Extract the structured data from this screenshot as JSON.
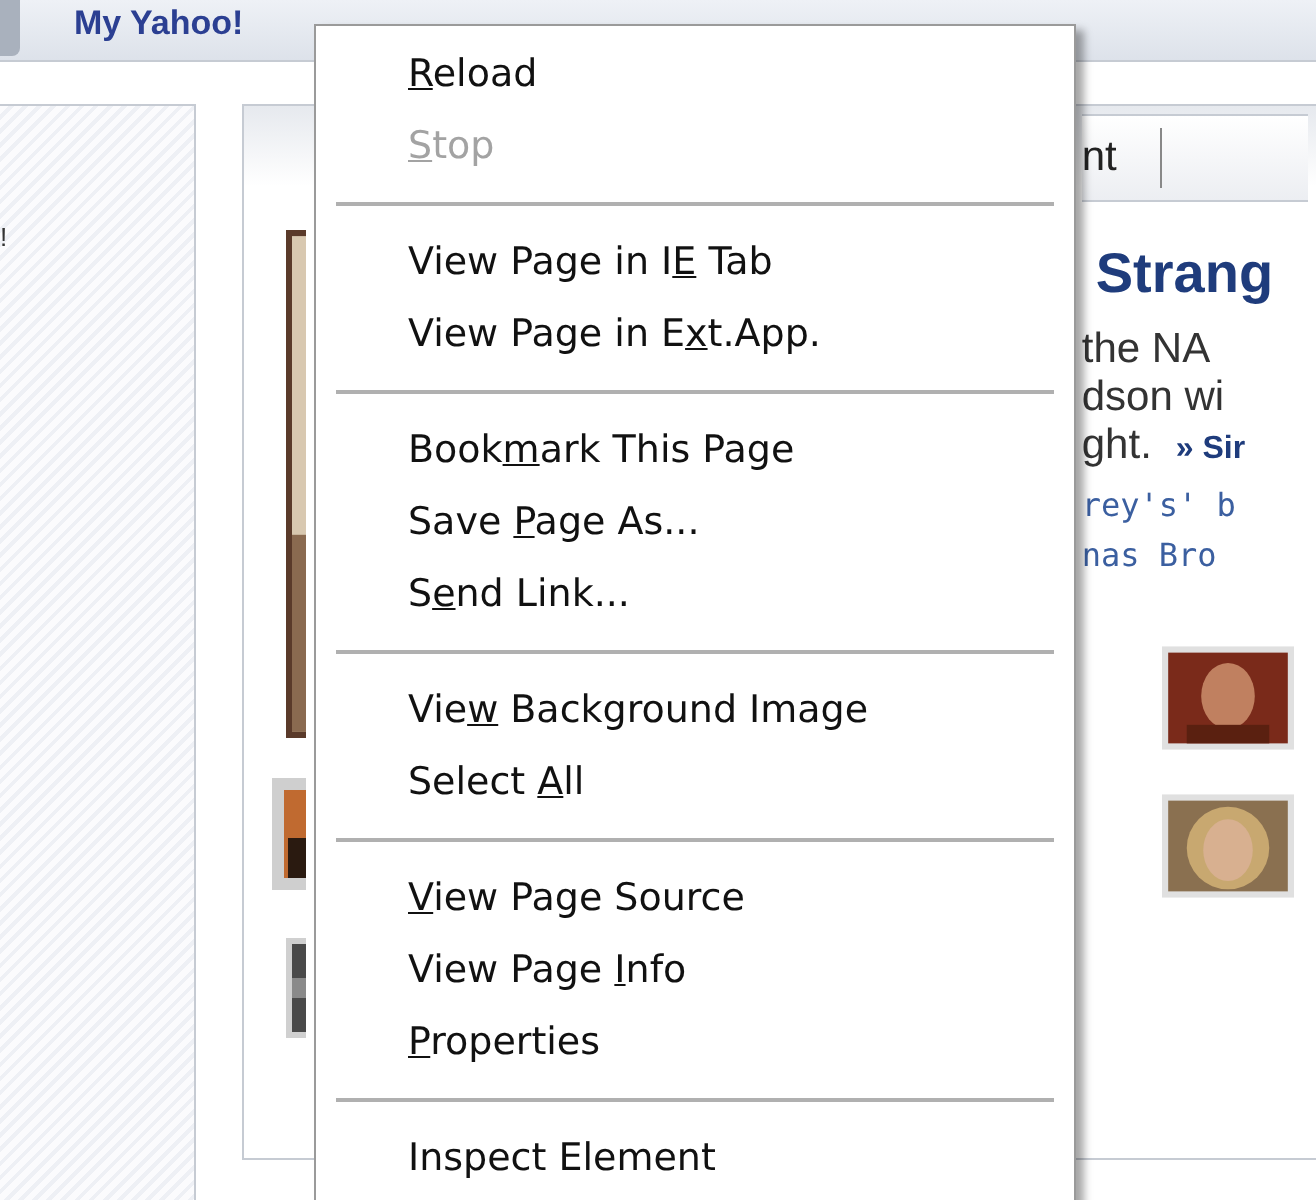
{
  "top_bar": {
    "link": "My Yahoo!"
  },
  "left_panel": {
    "texts": [
      "!"
    ]
  },
  "main_panel": {
    "tab": "nt",
    "headline": "Strang",
    "lines": [
      "the NA",
      "dson wi",
      "ght."
    ],
    "more_link": "» Sir",
    "links": [
      "rey's' b",
      "nas Bro"
    ]
  },
  "context_menu": {
    "groups": [
      [
        {
          "key": "R",
          "after": "eload",
          "disabled": false
        },
        {
          "key": "S",
          "after": "top",
          "disabled": true
        }
      ],
      [
        {
          "before": "View Page in I",
          "key": "E",
          "after": " Tab",
          "disabled": false
        },
        {
          "before": "View Page in E",
          "key": "x",
          "after": "t.App.",
          "disabled": false
        }
      ],
      [
        {
          "before": "Book",
          "key": "m",
          "after": "ark This Page",
          "disabled": false
        },
        {
          "before": "Save ",
          "key": "P",
          "after": "age As...",
          "disabled": false
        },
        {
          "before": "S",
          "key": "e",
          "after": "nd Link...",
          "disabled": false
        }
      ],
      [
        {
          "before": "Vie",
          "key": "w",
          "after": " Background Image",
          "disabled": false
        },
        {
          "before": "Select ",
          "key": "A",
          "after": "ll",
          "disabled": false
        }
      ],
      [
        {
          "key": "V",
          "after": "iew Page Source",
          "disabled": false
        },
        {
          "before": "View Page ",
          "key": "I",
          "after": "nfo",
          "disabled": false
        },
        {
          "key": "P",
          "after": "roperties",
          "disabled": false
        }
      ],
      [
        {
          "before": "Inspect Element",
          "disabled": false
        }
      ]
    ]
  }
}
